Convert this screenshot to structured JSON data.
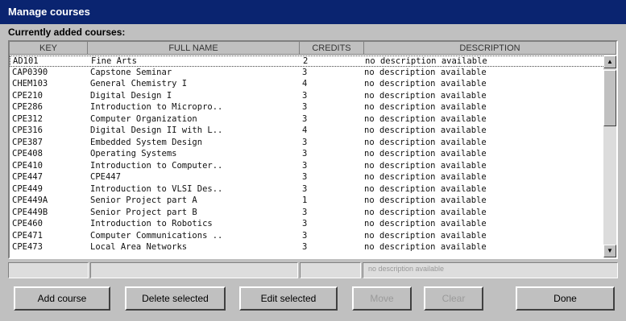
{
  "window": {
    "title": "Manage courses"
  },
  "section_label": "Currently added courses:",
  "columns": [
    "KEY",
    "FULL NAME",
    "CREDITS",
    "DESCRIPTION"
  ],
  "courses": [
    [
      "AD101",
      "Fine Arts",
      "2",
      "no description available"
    ],
    [
      "CAP0390",
      "Capstone Seminar",
      "3",
      "no description available"
    ],
    [
      "CHEM103",
      "General Chemistry I",
      "4",
      "no description available"
    ],
    [
      "CPE210",
      "Digital Design I",
      "3",
      "no description available"
    ],
    [
      "CPE286",
      "Introduction to Micropro..",
      "3",
      "no description available"
    ],
    [
      "CPE312",
      "Computer Organization",
      "3",
      "no description available"
    ],
    [
      "CPE316",
      "Digital Design II with L..",
      "4",
      "no description available"
    ],
    [
      "CPE387",
      "Embedded System Design",
      "3",
      "no description available"
    ],
    [
      "CPE408",
      "Operating Systems",
      "3",
      "no description available"
    ],
    [
      "CPE410",
      "Introduction to Computer..",
      "3",
      "no description available"
    ],
    [
      "CPE447",
      "CPE447",
      "3",
      "no description available"
    ],
    [
      "CPE449",
      "Introduction to VLSI Des..",
      "3",
      "no description available"
    ],
    [
      "CPE449A",
      "Senior Project part A",
      "1",
      "no description available"
    ],
    [
      "CPE449B",
      "Senior Project part B",
      "3",
      "no description available"
    ],
    [
      "CPE460",
      "Introduction to Robotics",
      "3",
      "no description available"
    ],
    [
      "CPE471",
      "Computer Communications ..",
      "3",
      "no description available"
    ],
    [
      "CPE473",
      "Local Area Networks",
      "3",
      "no description available"
    ]
  ],
  "edit_row": {
    "description": "no description available"
  },
  "scrollbar": {
    "up": "▲",
    "down": "▼"
  },
  "buttons": {
    "add": "Add course",
    "delete": "Delete selected",
    "edit": "Edit selected",
    "disabled1": "Move",
    "disabled2": "Clear",
    "done": "Done"
  }
}
